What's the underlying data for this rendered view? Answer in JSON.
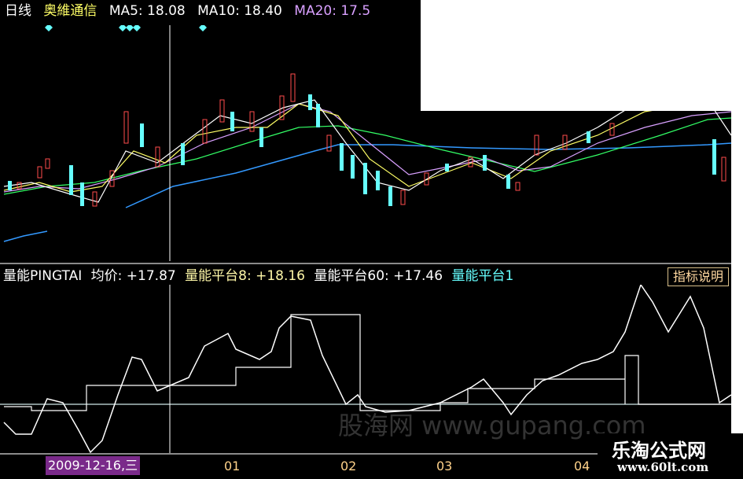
{
  "header": {
    "period": "日线",
    "stock_name": "奥維通信",
    "ma5": "MA5: 18.08",
    "ma10": "MA10: 18.40",
    "ma20": "MA20: 17.5"
  },
  "indicator": {
    "name": "量能PINGTAI",
    "avg": "均价: +17.87",
    "platform8": "量能平台8: +18.16",
    "platform60": "量能平台60: +17.46",
    "platform1": "量能平台1",
    "desc_button": "指标说明"
  },
  "date_axis": {
    "cursor_date": "2009-12-16,三",
    "ticks": [
      "01",
      "02",
      "03",
      "04"
    ]
  },
  "watermark": {
    "site_cn": "乐淘公式网",
    "site_url": "www.60lt.com",
    "faint": "股海网 www.gupang.com"
  },
  "colors": {
    "up_candle": "#ff4d4d",
    "down_candle": "#66ffff",
    "ma5": "#ffffff",
    "ma10": "#ffff66",
    "ma20": "#d9a0ff",
    "ma60": "#33ff66",
    "ma120": "#3399ff",
    "indicator_line": "#ffffff",
    "cursor": "#ffffff"
  }
}
